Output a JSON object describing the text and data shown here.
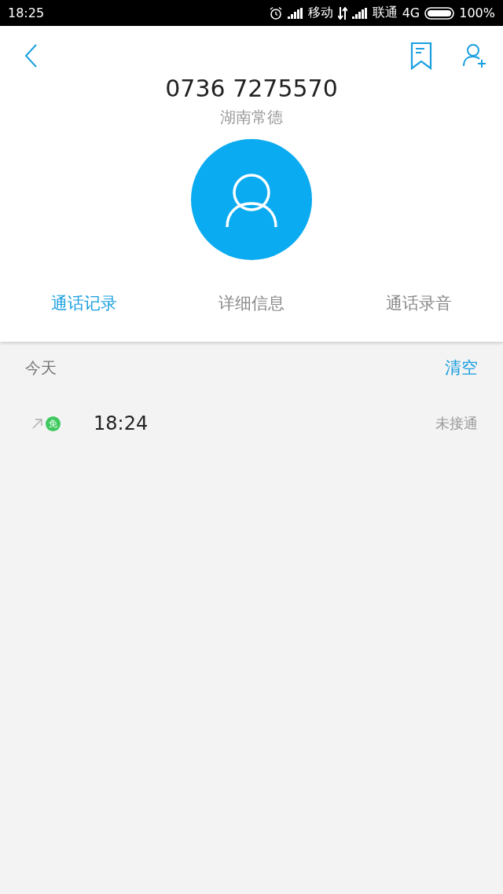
{
  "status_bar": {
    "time": "18:25",
    "carrier_1": "移动",
    "carrier_2": "联通",
    "network": "4G",
    "battery": "100%"
  },
  "contact": {
    "number": "0736 7275570",
    "location": "湖南常德"
  },
  "tabs": [
    {
      "label": "通话记录",
      "selected": true
    },
    {
      "label": "详细信息",
      "selected": false
    },
    {
      "label": "通话录音",
      "selected": false
    }
  ],
  "call_log": {
    "day": "今天",
    "clear": "清空",
    "calls": [
      {
        "badge": "免",
        "time": "18:24",
        "status": "未接通"
      }
    ]
  }
}
